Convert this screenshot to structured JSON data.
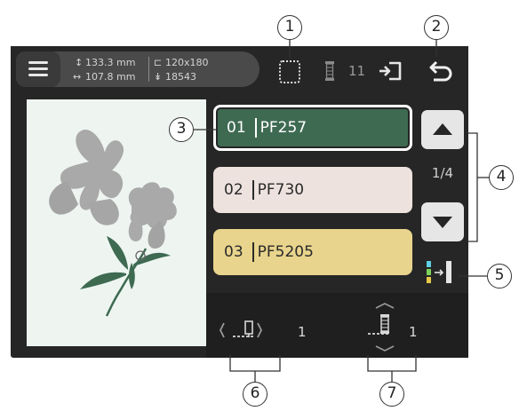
{
  "topbar": {
    "height_value": "133.3 mm",
    "width_value": "107.8 mm",
    "hoop_size": "120x180",
    "stitch_count": "18543",
    "spool_count": "11"
  },
  "threads": [
    {
      "number": "01",
      "code": "PF257",
      "color": "#3e6a52",
      "selected": true
    },
    {
      "number": "02",
      "code": "PF730",
      "color": "#ede2de",
      "selected": false
    },
    {
      "number": "03",
      "code": "PF5205",
      "color": "#e8d48c",
      "selected": false
    }
  ],
  "page_indicator": "1/4",
  "bottombar": {
    "tension_value": "1",
    "spool_value": "1"
  },
  "callouts": [
    "1",
    "2",
    "3",
    "4",
    "5",
    "6",
    "7"
  ],
  "icons": [
    "menu-icon",
    "frame-icon",
    "spool-icon",
    "color-cycle-icon",
    "back-icon",
    "scroll-up-icon",
    "scroll-down-icon",
    "color-sort-icon",
    "tension-icon",
    "spool-adjust-icon"
  ],
  "colors": {
    "screen": "#262626",
    "preview_bg": "#eef5f1",
    "leaf": "#3e6a52",
    "flower": "#9a9a9a"
  }
}
